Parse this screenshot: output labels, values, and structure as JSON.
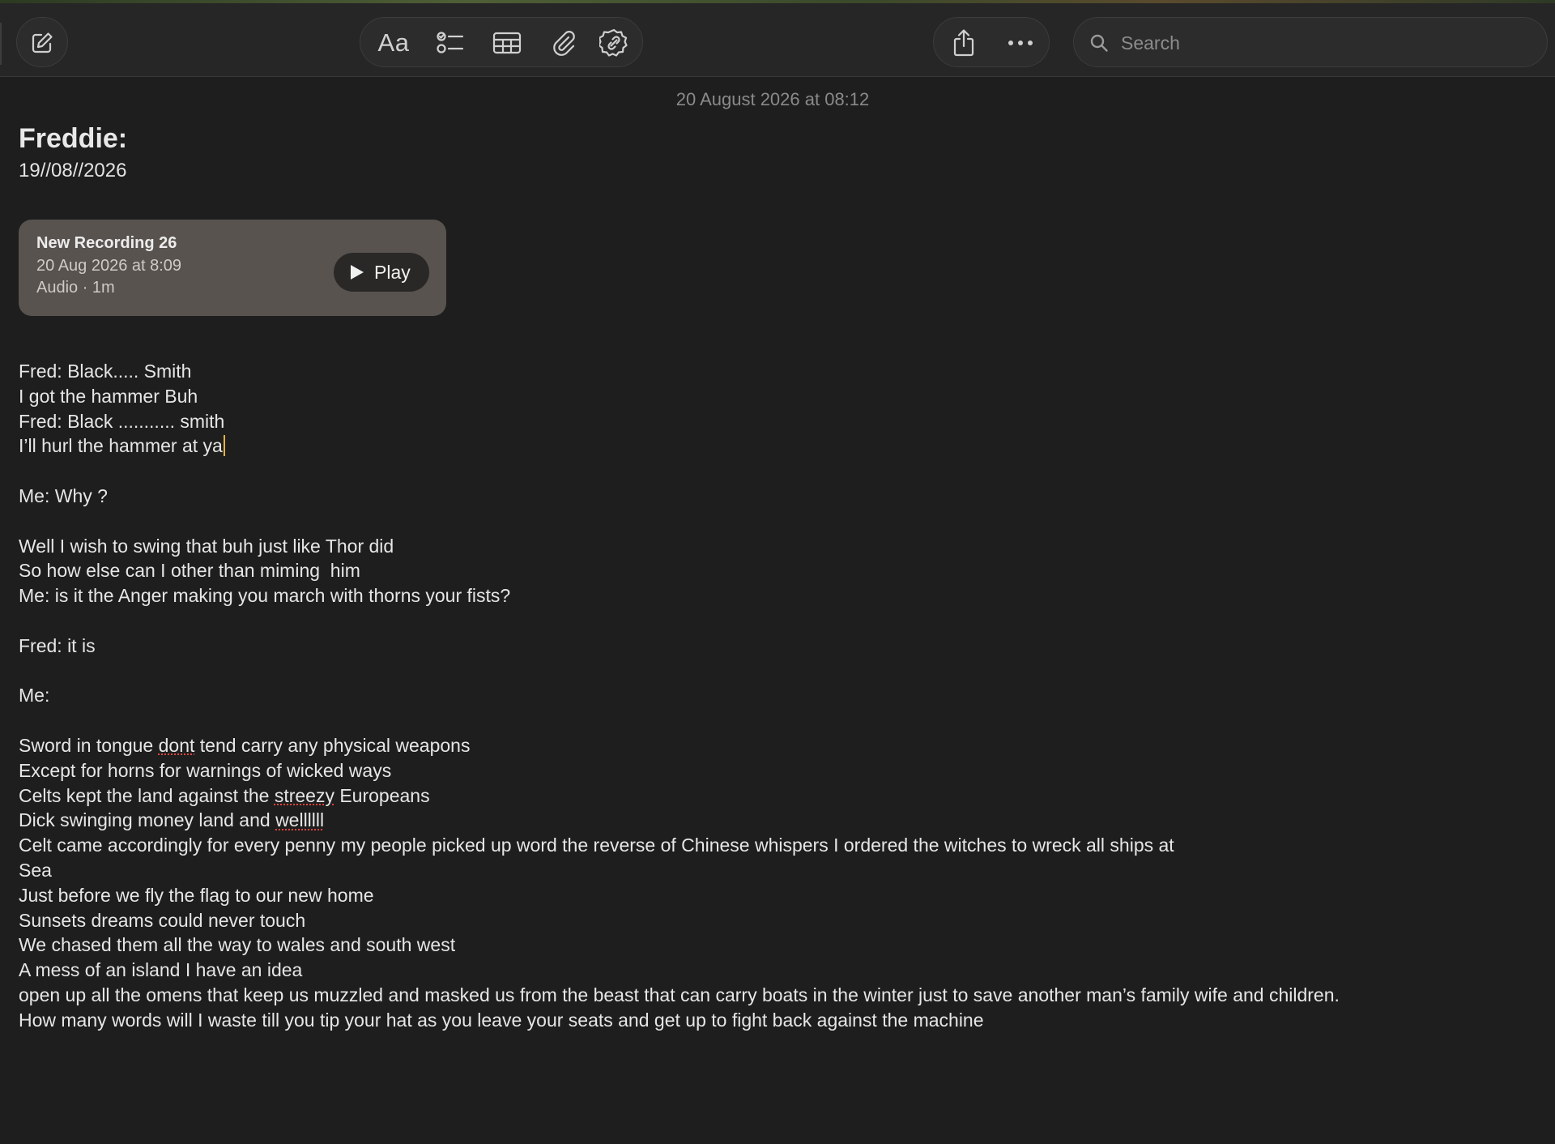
{
  "toolbar": {
    "format_label": "Aa",
    "search": {
      "placeholder": "Search"
    },
    "icons": {
      "compose": "compose-icon",
      "format": "text-format-icon",
      "checklist": "checklist-icon",
      "table": "table-icon",
      "attachment": "paperclip-icon",
      "link": "link-badge-icon",
      "share": "share-icon",
      "more": "more-icon",
      "search": "search-icon"
    }
  },
  "note": {
    "timestamp": "20 August 2026 at 08:12",
    "title": "Freddie:",
    "subtitle": "19//08//2026",
    "recording": {
      "title": "New Recording 26",
      "date": "20 Aug 2026 at 8:09",
      "meta": "Audio · 1m",
      "play_label": "Play"
    },
    "body": {
      "l1": "Fred: Black..... Smith",
      "l2": "I got the hammer Buh",
      "l3": "Fred: Black ........... smith",
      "l4": "I’ll hurl the hammer at ya",
      "l5": "Me: Why ?",
      "l6": "Well I wish to swing that buh just like Thor did",
      "l7": "So how else can I other than miming  him",
      "l8": "Me: is it the Anger making you march with thorns your fists?",
      "l9": "Fred: it is",
      "l10": "Me:",
      "l11_a": "Sword in tongue ",
      "l11_b": "dont",
      "l11_c": " tend carry any physical weapons",
      "l12": "Except for horns for warnings of wicked ways",
      "l13_a": "Celts kept the land against the ",
      "l13_b": "streezy",
      "l13_c": " Europeans",
      "l14_a": "Dick swinging money land and ",
      "l14_b": "wellllll",
      "l15": "Celt came accordingly for every penny my people picked up word the reverse of Chinese whispers I ordered the witches to wreck all ships at",
      "l16": "Sea",
      "l17": "Just before we fly the flag to our new home",
      "l18": "Sunsets dreams could never touch",
      "l19": "We chased them all the way to wales and south west",
      "l20": "A mess of an island I have an idea",
      "l21": "open up all the omens that keep us muzzled and masked us from the beast that can carry boats in the winter just to save another man’s family wife and children.",
      "l22": "How many words will I waste till you tip your hat as you leave your seats and get up to fight back against the machine"
    }
  },
  "colors": {
    "background": "#1e1e1e",
    "toolbar": "#262626",
    "card": "#58534f",
    "caret": "#e3b341",
    "spellcheck": "#e0463c"
  }
}
